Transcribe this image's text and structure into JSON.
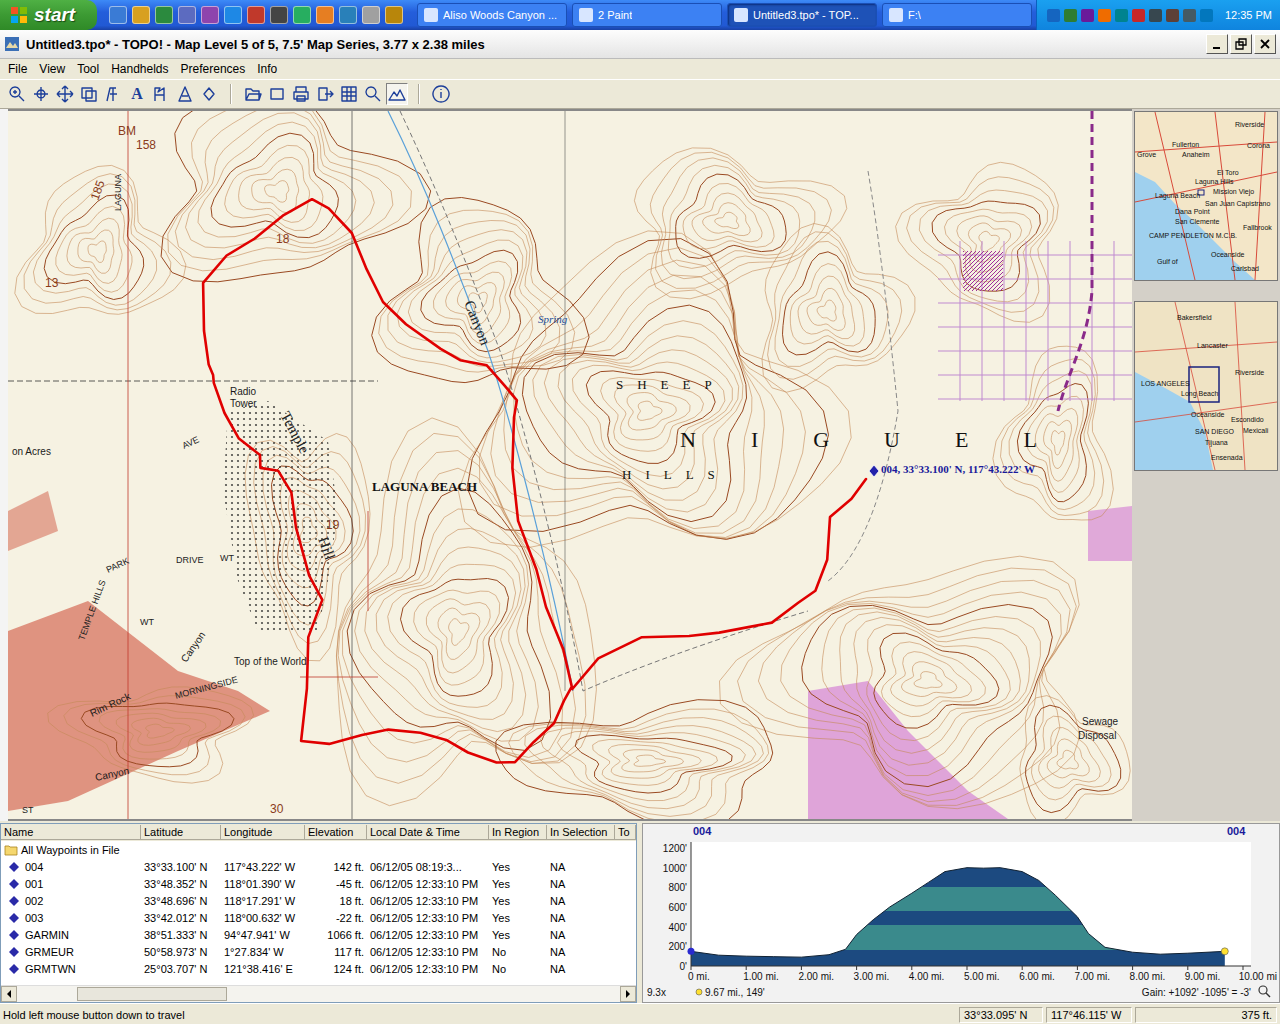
{
  "taskbar": {
    "start": "start",
    "tasks": [
      {
        "label": "Aliso Woods Canyon ...",
        "selected": false
      },
      {
        "label": "2 Paint",
        "selected": false
      },
      {
        "label": "Untitled3.tpo* - TOP...",
        "selected": true
      },
      {
        "label": "F:\\",
        "selected": false
      }
    ],
    "clock": "12:35 PM"
  },
  "window": {
    "title": "Untitled3.tpo* - TOPO! - Map Level 5 of 5, 7.5' Map Series, 3.77 x 2.38 miles"
  },
  "menu": [
    "File",
    "View",
    "Tool",
    "Handhelds",
    "Preferences",
    "Info"
  ],
  "toolbar": {
    "text_tool_glyph": "A"
  },
  "map": {
    "labels": [
      {
        "text": "BM",
        "kind": "number"
      },
      {
        "text": "158",
        "kind": "number"
      },
      {
        "text": "LAGUNA",
        "kind": "road"
      },
      {
        "text": "185",
        "kind": "number"
      },
      {
        "text": "18",
        "kind": "number"
      },
      {
        "text": "13",
        "kind": "number"
      },
      {
        "text": "Radio",
        "kind": "feature"
      },
      {
        "text": "Tower",
        "kind": "feature"
      },
      {
        "text": "Temple",
        "kind": "large"
      },
      {
        "text": "Hill",
        "kind": "large"
      },
      {
        "text": "on Acres",
        "kind": "feature"
      },
      {
        "text": "LAGUNA BEACH",
        "kind": "town"
      },
      {
        "text": "19",
        "kind": "number"
      },
      {
        "text": "PARK",
        "kind": "road"
      },
      {
        "text": "AVE",
        "kind": "road"
      },
      {
        "text": "DRIVE",
        "kind": "road"
      },
      {
        "text": "WT",
        "kind": "road"
      },
      {
        "text": "WT",
        "kind": "road"
      },
      {
        "text": "TEMPLE HILLS",
        "kind": "road"
      },
      {
        "text": "Top of the World",
        "kind": "feature"
      },
      {
        "text": "Rim Rock",
        "kind": "feature"
      },
      {
        "text": "Canyon",
        "kind": "feature"
      },
      {
        "text": "MORNINGSIDE",
        "kind": "road"
      },
      {
        "text": "Canyon",
        "kind": "feature"
      },
      {
        "text": "ST",
        "kind": "road"
      },
      {
        "text": "30",
        "kind": "number"
      },
      {
        "text": "Canyon",
        "kind": "large"
      },
      {
        "text": "Spring",
        "kind": "water"
      },
      {
        "text": "SHEEP",
        "kind": "spaced"
      },
      {
        "text": "HILLS",
        "kind": "spaced"
      },
      {
        "text": "NIGUEL",
        "kind": "bigspaced"
      },
      {
        "text": "Sewage",
        "kind": "feature"
      },
      {
        "text": "Disposal",
        "kind": "feature"
      }
    ],
    "waypoint": {
      "label": "004, 33°33.100' N, 117°43.222' W"
    }
  },
  "overview": {
    "regional": [
      "Riverside",
      "Fullerton",
      "Corona",
      "Anaheim",
      "Grove",
      "El Toro",
      "Laguna Hills",
      "Mission Viejo",
      "Laguna Beach",
      "San Juan Capistrano",
      "Dana Point",
      "San Clemente",
      "Fallbrook",
      "CAMP PENDLETON M.C.B.",
      "Gulf of",
      "Oceanside",
      "Carlsbad"
    ],
    "state": [
      "Bakersfield",
      "Lancaster",
      "LOS ANGELES",
      "Riverside",
      "Long Beach",
      "Oceanside",
      "Escondido",
      "SAN DIEGO",
      "Tijuana",
      "Mexicali",
      "Ensenada"
    ]
  },
  "waypoints": {
    "columns": [
      "Name",
      "Latitude",
      "Longitude",
      "Elevation",
      "Local Date & Time",
      "In Region",
      "In Selection",
      "To"
    ],
    "folder": "All Waypoints in File",
    "rows": [
      {
        "name": "004",
        "latitude": "33°33.100' N",
        "longitude": "117°43.222' W",
        "elevation": "142 ft.",
        "time": "06/12/05 08:19:3...",
        "in_region": "Yes",
        "in_selection": "NA"
      },
      {
        "name": "001",
        "latitude": "33°48.352' N",
        "longitude": "118°01.390' W",
        "elevation": "-45 ft.",
        "time": "06/12/05 12:33:10 PM",
        "in_region": "Yes",
        "in_selection": "NA"
      },
      {
        "name": "002",
        "latitude": "33°48.696' N",
        "longitude": "118°17.291' W",
        "elevation": "18 ft.",
        "time": "06/12/05 12:33:10 PM",
        "in_region": "Yes",
        "in_selection": "NA"
      },
      {
        "name": "003",
        "latitude": "33°42.012' N",
        "longitude": "118°00.632' W",
        "elevation": "-22 ft.",
        "time": "06/12/05 12:33:10 PM",
        "in_region": "Yes",
        "in_selection": "NA"
      },
      {
        "name": "GARMIN",
        "latitude": "38°51.333' N",
        "longitude": "94°47.941' W",
        "elevation": "1066 ft.",
        "time": "06/12/05 12:33:10 PM",
        "in_region": "Yes",
        "in_selection": "NA"
      },
      {
        "name": "GRMEUR",
        "latitude": "50°58.973' N",
        "longitude": "1°27.834' W",
        "elevation": "117 ft.",
        "time": "06/12/05 12:33:10 PM",
        "in_region": "No",
        "in_selection": "NA"
      },
      {
        "name": "GRMTWN",
        "latitude": "25°03.707' N",
        "longitude": "121°38.416' E",
        "elevation": "124 ft.",
        "time": "06/12/05 12:33:10 PM",
        "in_region": "No",
        "in_selection": "NA"
      }
    ]
  },
  "profile": {
    "start_label": "004",
    "end_label": "004",
    "y_ticks": [
      "0'",
      "200'",
      "400'",
      "600'",
      "800'",
      "1000'",
      "1200'"
    ],
    "x_ticks": [
      "0 mi.",
      "1.00 mi.",
      "2.00 mi.",
      "3.00 mi.",
      "4.00 mi.",
      "5.00 mi.",
      "6.00 mi.",
      "7.00 mi.",
      "8.00 mi.",
      "9.00 mi.",
      "10.00 mi"
    ],
    "distances": [
      0,
      0.5,
      1,
      1.5,
      2,
      2.5,
      2.8,
      3,
      3.3,
      3.6,
      4,
      4.3,
      4.6,
      5,
      5.3,
      5.6,
      6,
      6.3,
      6.6,
      7,
      7.2,
      7.5,
      8,
      8.5,
      9,
      9.67
    ],
    "elevations": [
      149,
      110,
      100,
      95,
      90,
      115,
      170,
      320,
      470,
      600,
      740,
      850,
      960,
      1000,
      995,
      1000,
      960,
      870,
      720,
      500,
      330,
      190,
      140,
      120,
      130,
      149
    ],
    "zoom": "9.3x",
    "cursor": "9.67 mi., 149'",
    "gain": "Gain: +1092' -1095' = -3'"
  },
  "status_bar": {
    "hint": "Hold left mouse button down to travel",
    "latitude": "33°33.095' N",
    "longitude": "117°46.115' W",
    "elevation": "375 ft."
  }
}
